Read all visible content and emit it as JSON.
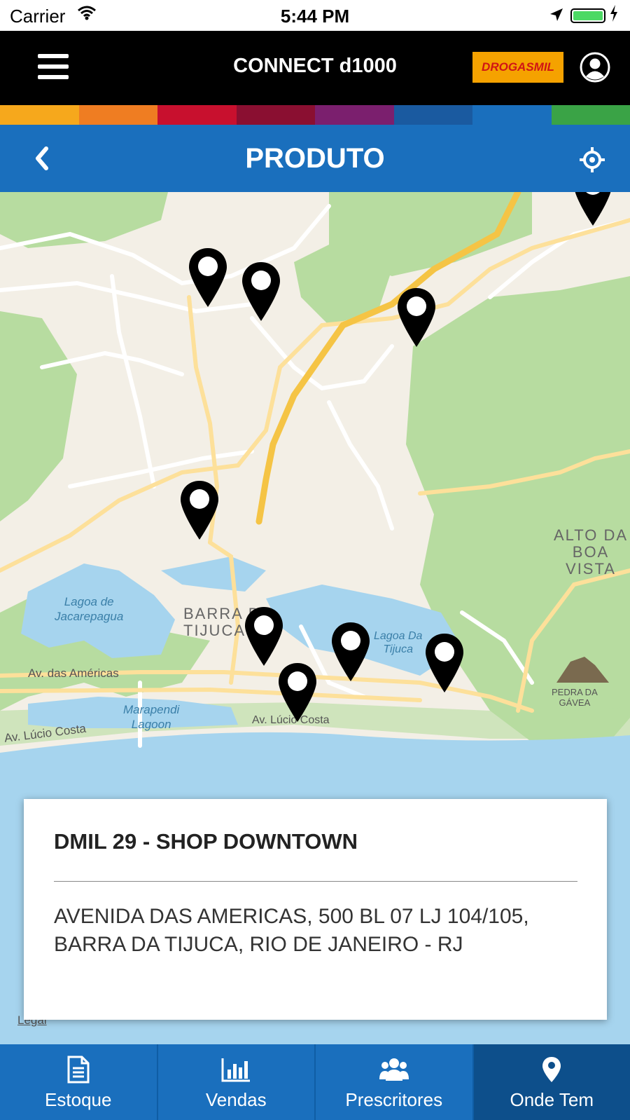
{
  "status_bar": {
    "carrier": "Carrier",
    "time": "5:44 PM"
  },
  "header": {
    "title": "CONNECT d1000",
    "logo_text": "DROGASMIL"
  },
  "color_strip": [
    "#f6a81c",
    "#ef7d22",
    "#c8102e",
    "#8a0f31",
    "#7b1f6e",
    "#1a5aa0",
    "#1a6fbd",
    "#3aa346"
  ],
  "page": {
    "title": "PRODUTO"
  },
  "map": {
    "labels": {
      "alto_da_boa_vista": "ALTO DA\nBOA VISTA",
      "lagoa_jacarepagua": "Lagoa de\nJacarepagua",
      "barra_tijuca": "BARRA DA\nTIJUCA",
      "lagoa_tijuca": "Lagoa Da\nTijuca",
      "av_americas": "Av. das Américas",
      "marapendi": "Marapendi\nLagoon",
      "av_lucio_costa_1": "Av. Lúcio Costa",
      "av_lucio_costa_2": "Av. Lúcio Costa",
      "pedra_da_gavea": "PEDRA DA\nGÁVEA"
    },
    "legal": "Legal"
  },
  "store": {
    "name": "DMIL 29 - SHOP DOWNTOWN",
    "address": "AVENIDA DAS AMERICAS, 500 BL 07 LJ 104/105, BARRA DA TIJUCA, RIO DE JANEIRO - RJ"
  },
  "tabs": [
    {
      "label": "Estoque",
      "icon": "document-icon"
    },
    {
      "label": "Vendas",
      "icon": "bar-chart-icon"
    },
    {
      "label": "Prescritores",
      "icon": "users-icon"
    },
    {
      "label": "Onde Tem",
      "icon": "location-pin-icon",
      "active": true
    }
  ]
}
